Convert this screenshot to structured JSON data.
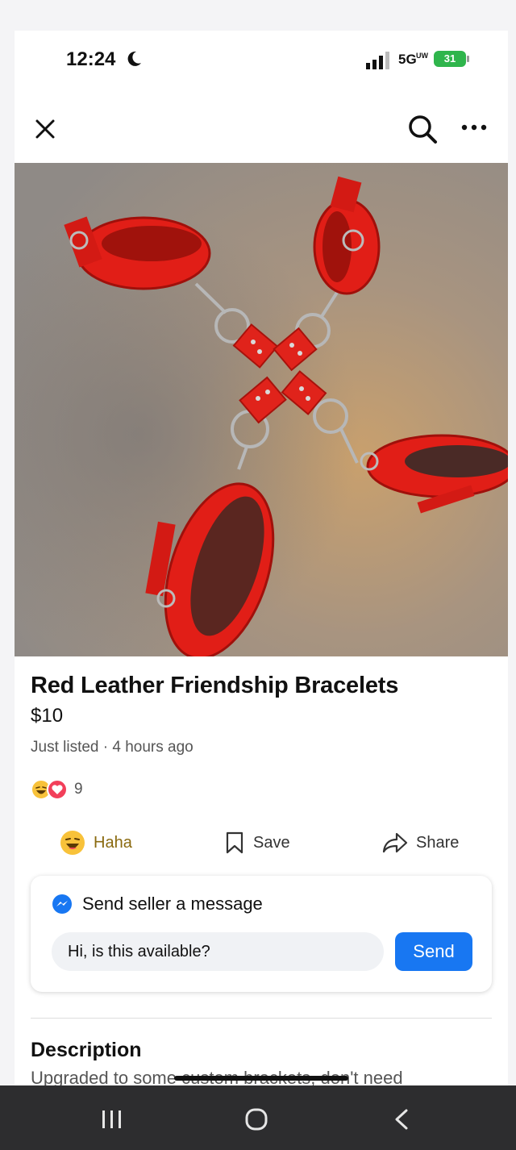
{
  "status_bar": {
    "time": "12:24",
    "network": "5G",
    "network_sub": "UW",
    "battery": "31"
  },
  "listing": {
    "title": "Red Leather Friendship Bracelets",
    "price": "$10",
    "meta": "Just listed · 4 hours ago",
    "reaction_count": "9"
  },
  "actions": {
    "haha_label": "Haha",
    "save_label": "Save",
    "share_label": "Share"
  },
  "message": {
    "heading": "Send seller a message",
    "input_value": "Hi, is this available?",
    "send_label": "Send"
  },
  "description": {
    "heading": "Description",
    "text": "Upgraded to some custom brackets, don't need"
  },
  "colors": {
    "accent": "#1877f2",
    "battery": "#2fb54c",
    "haha": "#f8c23a",
    "love": "#f23f5a"
  },
  "icons": [
    "moon-icon",
    "signal-icon",
    "close-icon",
    "search-icon",
    "more-icon",
    "haha-icon",
    "heart-icon",
    "bookmark-icon",
    "share-icon",
    "messenger-icon",
    "recents-icon",
    "home-icon",
    "back-icon"
  ]
}
